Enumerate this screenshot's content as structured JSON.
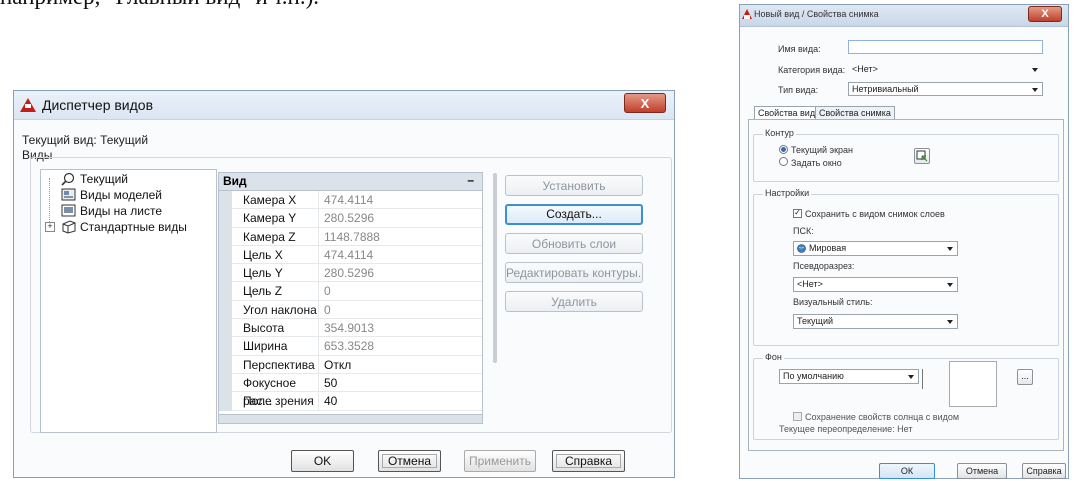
{
  "caption": "например, \"Главный вид\" и т.п.).",
  "view_manager": {
    "title": "Диспетчер видов",
    "close_label": "X",
    "current_view": "Текущий вид: Текущий",
    "views_label": "Виды",
    "tree": [
      "Текущий",
      "Виды моделей",
      "Виды на листе",
      "Стандартные виды"
    ],
    "grid_header": "Вид",
    "grid_collapse": "–",
    "properties": [
      {
        "name": "Камера X",
        "value": "474.4114"
      },
      {
        "name": "Камера Y",
        "value": "280.5296"
      },
      {
        "name": "Камера Z",
        "value": "1148.7888"
      },
      {
        "name": "Цель X",
        "value": "474.4114"
      },
      {
        "name": "Цель Y",
        "value": "280.5296"
      },
      {
        "name": "Цель Z",
        "value": "0"
      },
      {
        "name": "Угол наклона",
        "value": "0"
      },
      {
        "name": "Высота",
        "value": "354.9013"
      },
      {
        "name": "Ширина",
        "value": "653.3528"
      },
      {
        "name": "Перспектива",
        "value": "Откл"
      },
      {
        "name": "Фокусное рас...",
        "value": "50"
      },
      {
        "name": "Поле зрения",
        "value": "40"
      }
    ],
    "side_buttons": [
      "Установить",
      "Создать...",
      "Обновить слои",
      "Редактировать контуры...",
      "Удалить"
    ],
    "bottom_buttons": {
      "ok": "OK",
      "cancel": "Отмена",
      "apply": "Применить",
      "help": "Справка"
    }
  },
  "new_view": {
    "title": "Новый вид / Свойства снимка",
    "close_label": "X",
    "view_name_label": "Имя вида:",
    "view_name_value": "",
    "category_label": "Категория вида:",
    "category_value": "<Нет>",
    "type_label": "Тип вида:",
    "type_value": "Нетривиальный",
    "tabs": [
      "Свойства вида",
      "Свойства снимка"
    ],
    "boundary": {
      "title": "Контур",
      "opt_current": "Текущий экран",
      "opt_window": "Задать окно"
    },
    "settings": {
      "title": "Настройки",
      "save_layers": "Сохранить с видом снимок слоев",
      "ucs_label": "ПСК:",
      "ucs_value": "Мировая",
      "section_label": "Псевдоразрез:",
      "section_value": "<Нет>",
      "visual_style_label": "Визуальный стиль:",
      "visual_style_value": "Текущий"
    },
    "background": {
      "title": "Фон",
      "value": "По умолчанию",
      "browse": "...",
      "save_sun": "Сохранение свойств солнца с видом",
      "override": "Текущее переопределение: Нет"
    },
    "buttons": {
      "ok": "ОК",
      "cancel": "Отмена",
      "help": "Справка"
    }
  }
}
